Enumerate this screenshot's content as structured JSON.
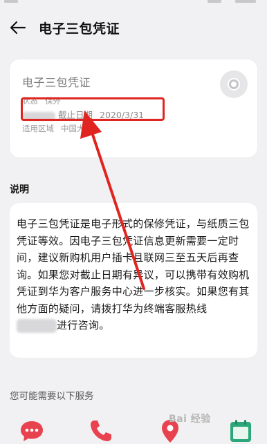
{
  "header": {
    "title": "电子三包凭证"
  },
  "card": {
    "title": "电子三包凭证",
    "status_label": "状态",
    "status_value": "保外",
    "expiry_label": "截止日期",
    "expiry_value": "2020/3/31",
    "region_label": "适用区域",
    "region_value": "中国大陆"
  },
  "description": {
    "section_label": "说明",
    "body_before_blur": "电子三包凭证是电子形式的保修凭证，与纸质三包凭证等效。因电子三包凭证信息更新需要一定时间，建议新购机用户插卡且联网三至五天后再查询。如果您对截止日期有异议，可以携带有效购机凭证到华为客户服务中心进一步核实。如果您有其他方面的疑问，请拨打华为终端客服热线",
    "body_after_blur": "进行咨询。"
  },
  "services": {
    "label": "您可能需要以下服务",
    "items": [
      {
        "icon": "chat-icon",
        "color": "#e8424f"
      },
      {
        "icon": "phone-icon",
        "color": "#e8424f"
      },
      {
        "icon": "location-pin-icon",
        "color": "#e8424f"
      },
      {
        "icon": "calendar-icon",
        "color": "#2aa879"
      }
    ]
  },
  "annotation": {
    "highlight_color": "#e0241f"
  },
  "watermark": {
    "text": "Bai 经验"
  }
}
